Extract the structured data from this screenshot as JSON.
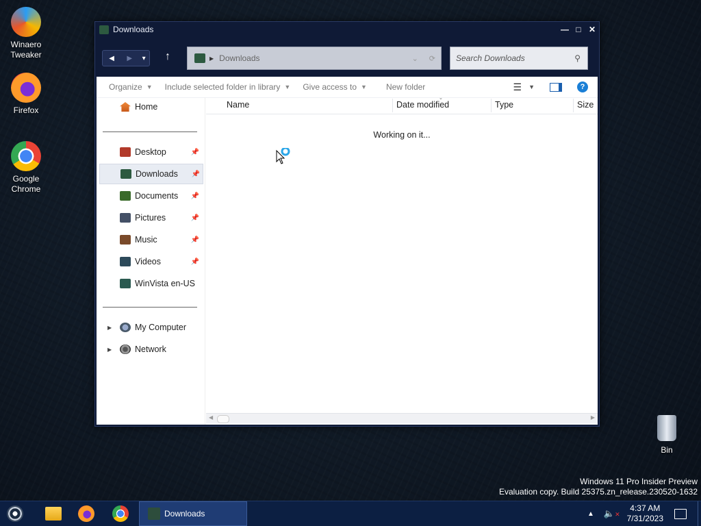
{
  "desktop": {
    "icons": [
      {
        "label": "Winaero Tweaker"
      },
      {
        "label": "Firefox"
      },
      {
        "label": "Google Chrome"
      },
      {
        "label": "Bin"
      }
    ],
    "watermark_line1": "Windows 11 Pro Insider Preview",
    "watermark_line2": "Evaluation copy. Build 25375.zn_release.230520-1632"
  },
  "window": {
    "title": "Downloads",
    "address": "Downloads",
    "search_placeholder": "Search Downloads",
    "commands": {
      "organize": "Organize",
      "include_library": "Include selected folder in library",
      "give_access": "Give access to",
      "new_folder": "New folder"
    },
    "nav": {
      "home": "Home",
      "pinned": [
        "Desktop",
        "Downloads",
        "Documents",
        "Pictures",
        "Music",
        "Videos",
        "WinVista en-US"
      ],
      "selected": "Downloads",
      "bottom": [
        "My Computer",
        "Network"
      ]
    },
    "columns": [
      "Name",
      "Date modified",
      "Type",
      "Size"
    ],
    "status": "Working on it..."
  },
  "taskbar": {
    "active_window": "Downloads",
    "time": "4:37 AM",
    "date": "7/31/2023"
  },
  "colors": {
    "window_frame": "#0f1a36",
    "taskbar": "#0c1f42",
    "accent": "#1a7fd6"
  }
}
